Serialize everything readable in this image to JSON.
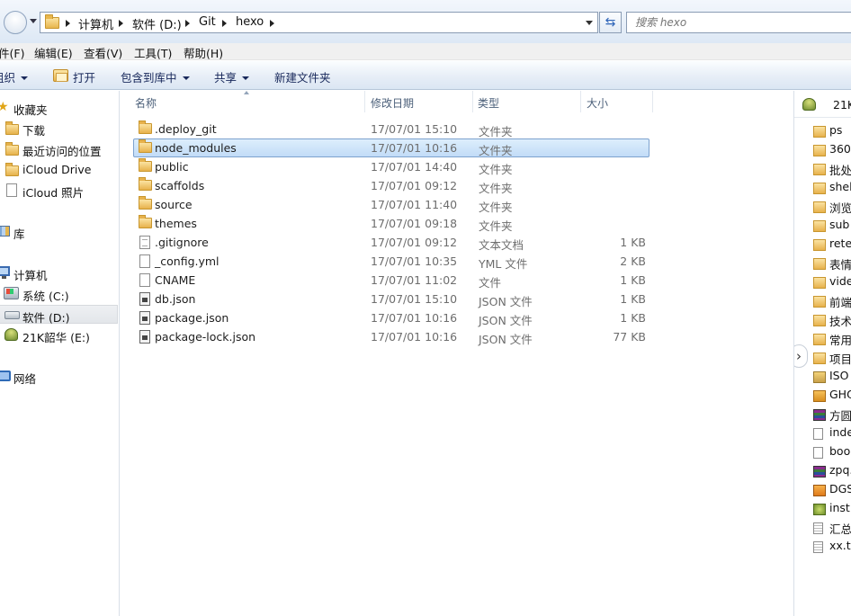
{
  "address_bar": {
    "breadcrumbs": [
      "计算机",
      "软件 (D:)",
      "Git",
      "hexo"
    ],
    "search_placeholder": "搜索 hexo"
  },
  "menu": [
    "件(F)",
    "编辑(E)",
    "查看(V)",
    "工具(T)",
    "帮助(H)"
  ],
  "toolbar": {
    "organize": "组织",
    "open": "打开",
    "include_library": "包含到库中",
    "share": "共享",
    "new_folder": "新建文件夹"
  },
  "nav": {
    "favorites": {
      "label": "收藏夹",
      "items": [
        "下载",
        "最近访问的位置",
        "iCloud Drive",
        "iCloud 照片"
      ]
    },
    "library": "库",
    "computer": {
      "label": "计算机",
      "drives": [
        "系统 (C:)",
        "软件 (D:)",
        "21K韶华 (E:)"
      ]
    },
    "network": "网络"
  },
  "columns": {
    "name": "名称",
    "modified": "修改日期",
    "type": "类型",
    "size": "大小"
  },
  "files": [
    {
      "name": ".deploy_git",
      "date": "17/07/01 15:10",
      "type": "文件夹",
      "size": "",
      "icon": "folder-icon"
    },
    {
      "name": "node_modules",
      "date": "17/07/01 10:16",
      "type": "文件夹",
      "size": "",
      "icon": "folder-icon"
    },
    {
      "name": "public",
      "date": "17/07/01 14:40",
      "type": "文件夹",
      "size": "",
      "icon": "folder-icon"
    },
    {
      "name": "scaffolds",
      "date": "17/07/01 09:12",
      "type": "文件夹",
      "size": "",
      "icon": "folder-icon"
    },
    {
      "name": "source",
      "date": "17/07/01 11:40",
      "type": "文件夹",
      "size": "",
      "icon": "folder-icon"
    },
    {
      "name": "themes",
      "date": "17/07/01 09:18",
      "type": "文件夹",
      "size": "",
      "icon": "folder-icon"
    },
    {
      "name": ".gitignore",
      "date": "17/07/01 09:12",
      "type": "文本文档",
      "size": "1 KB",
      "icon": "text-file-icon"
    },
    {
      "name": "_config.yml",
      "date": "17/07/01 10:35",
      "type": "YML 文件",
      "size": "2 KB",
      "icon": "file-icon"
    },
    {
      "name": "CNAME",
      "date": "17/07/01 11:02",
      "type": "文件",
      "size": "1 KB",
      "icon": "file-icon"
    },
    {
      "name": "db.json",
      "date": "17/07/01 15:10",
      "type": "JSON 文件",
      "size": "1 KB",
      "icon": "json-file-icon"
    },
    {
      "name": "package.json",
      "date": "17/07/01 10:16",
      "type": "JSON 文件",
      "size": "1 KB",
      "icon": "json-file-icon"
    },
    {
      "name": "package-lock.json",
      "date": "17/07/01 10:16",
      "type": "JSON 文件",
      "size": "77 KB",
      "icon": "json-file-icon"
    }
  ],
  "selected_file": "node_modules",
  "right_pane": {
    "header": "21K",
    "items": [
      {
        "label": "ps",
        "icon": "folder-icon"
      },
      {
        "label": "360",
        "icon": "folder-icon"
      },
      {
        "label": "批处",
        "icon": "folder-icon"
      },
      {
        "label": "shell",
        "icon": "folder-icon"
      },
      {
        "label": "浏览",
        "icon": "folder-icon"
      },
      {
        "label": "sub",
        "icon": "folder-icon"
      },
      {
        "label": "retec",
        "icon": "folder-icon"
      },
      {
        "label": "表情",
        "icon": "folder-icon"
      },
      {
        "label": "vide",
        "icon": "folder-icon"
      },
      {
        "label": "前端",
        "icon": "folder-icon"
      },
      {
        "label": "技术",
        "icon": "folder-icon"
      },
      {
        "label": "常用",
        "icon": "folder-icon"
      },
      {
        "label": "项目",
        "icon": "folder-icon"
      },
      {
        "label": "ISO",
        "icon": "iso-icon"
      },
      {
        "label": "GHO",
        "icon": "gho-icon"
      },
      {
        "label": "方圆",
        "icon": "archive-icon"
      },
      {
        "label": "inde",
        "icon": "file-icon"
      },
      {
        "label": "boo",
        "icon": "file-icon"
      },
      {
        "label": "zpq.",
        "icon": "archive-icon"
      },
      {
        "label": "DGS",
        "icon": "app-icon"
      },
      {
        "label": "inst.",
        "icon": "installer-icon"
      },
      {
        "label": "汇总",
        "icon": "text-file-icon"
      },
      {
        "label": "xx.tx",
        "icon": "text-file-icon"
      }
    ]
  },
  "colors": {
    "selection_fill": "#cce4f9",
    "selection_border": "#7da2ce",
    "folder": "#e7b24c",
    "header_text": "#4c607a"
  }
}
